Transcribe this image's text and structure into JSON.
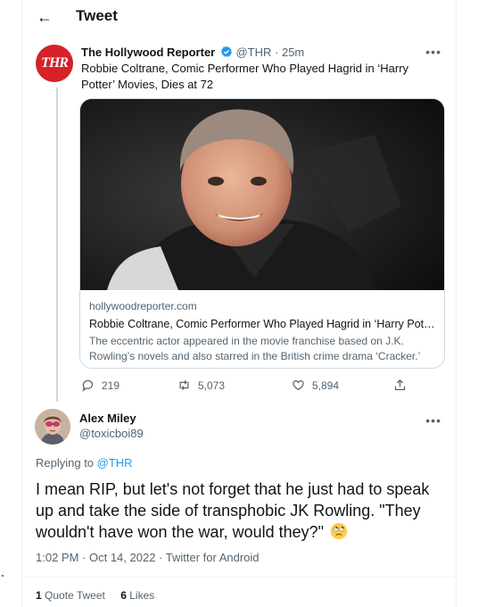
{
  "header": {
    "title": "Tweet",
    "back_icon": "back-arrow-icon"
  },
  "tweet1": {
    "avatar_text": "THR",
    "author_name": "The Hollywood Reporter",
    "handle": "@THR",
    "separator": " · ",
    "time": "25m",
    "text": "Robbie Coltrane, Comic Performer Who Played Hagrid in ‘Harry Potter’ Movies, Dies at 72",
    "card": {
      "domain": "hollywoodreporter.com",
      "title": "Robbie Coltrane, Comic Performer Who Played Hagrid in ‘Harry Potter…",
      "description": "The eccentric actor appeared in the movie franchise based on J.K. Rowling’s novels and also starred in the British crime drama ‘Cracker.’"
    },
    "actions": {
      "replies": "219",
      "retweets": "5,073",
      "likes": "5,894"
    }
  },
  "tweet2": {
    "author_name": "Alex Miley",
    "handle": "@toxicboi89",
    "replying_prefix": "Replying to ",
    "replying_to": "@THR",
    "text": "I mean RIP, but let's not forget that he just had to speak up and take the side of transphobic JK Rowling. \"They wouldn't have won the war, would they?\"",
    "emoji": "face-with-rolling-eyes",
    "time": "1:02 PM",
    "separator": " · ",
    "date": "Oct 14, 2022",
    "source": "Twitter for Android",
    "quote_count": "1",
    "quote_label": "Quote Tweet",
    "like_count": "6",
    "like_label": "Likes"
  },
  "colors": {
    "accent": "#1d9bf0",
    "muted": "#536471",
    "thr_red": "#d62128"
  }
}
